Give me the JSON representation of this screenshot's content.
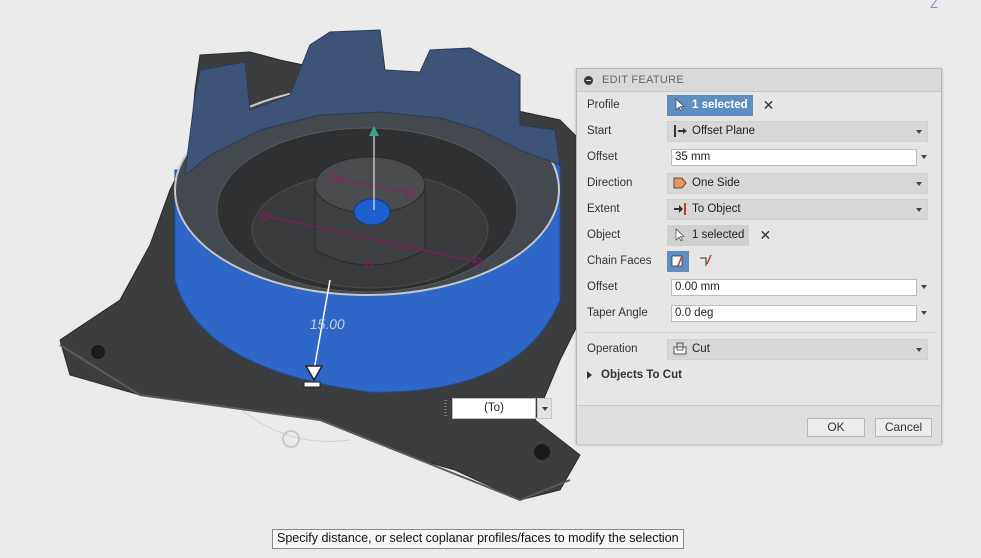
{
  "viewport": {
    "dimension_label": "15.00",
    "axis_label": "Z",
    "extent_dropdown_value": "(To)"
  },
  "dialog": {
    "title": "EDIT FEATURE",
    "rows": {
      "profile": {
        "label": "Profile",
        "value": "1 selected"
      },
      "start": {
        "label": "Start",
        "value": "Offset Plane"
      },
      "offset": {
        "label": "Offset",
        "value": "35 mm"
      },
      "direction": {
        "label": "Direction",
        "value": "One Side"
      },
      "extent": {
        "label": "Extent",
        "value": "To Object"
      },
      "object": {
        "label": "Object",
        "value": "1 selected"
      },
      "chain_faces": {
        "label": "Chain Faces"
      },
      "offset2": {
        "label": "Offset",
        "value": "0.00 mm"
      },
      "taper": {
        "label": "Taper Angle",
        "value": "0.0 deg"
      },
      "operation": {
        "label": "Operation",
        "value": "Cut"
      }
    },
    "objects_to_cut": "Objects To Cut",
    "ok_label": "OK",
    "cancel_label": "Cancel"
  },
  "status_tooltip": "Specify distance, or select coplanar profiles/faces to modify the selection",
  "colors": {
    "accent": "#5e8ec2",
    "body_dark": "#3c3d3e",
    "extrude_blue": "#2f67c9",
    "sketch_magenta": "#a0106a"
  }
}
